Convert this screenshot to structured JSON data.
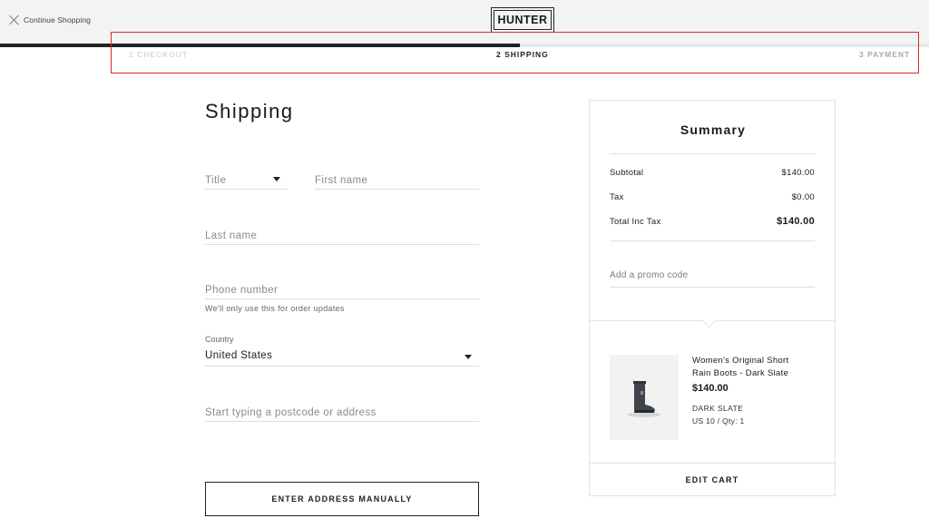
{
  "header": {
    "continue_label": "Continue Shopping",
    "logo_text": "HUNTER"
  },
  "progress": {
    "fraction_complete": 0.56
  },
  "steps": [
    {
      "label": "1 CHECKOUT",
      "state": "completed"
    },
    {
      "label": "2 SHIPPING",
      "state": "current"
    },
    {
      "label": "3 PAYMENT",
      "state": "upcoming"
    }
  ],
  "form": {
    "heading": "Shipping",
    "title_placeholder": "Title",
    "first_name_placeholder": "First name",
    "last_name_placeholder": "Last name",
    "phone_placeholder": "Phone number",
    "phone_hint": "We'll only use this for order updates",
    "country_label": "Country",
    "country_value": "United States",
    "address_placeholder": "Start typing a postcode or address",
    "manual_button": "ENTER ADDRESS MANUALLY"
  },
  "summary": {
    "heading": "Summary",
    "subtotal_label": "Subtotal",
    "subtotal_value": "$140.00",
    "tax_label": "Tax",
    "tax_value": "$0.00",
    "total_label": "Total Inc Tax",
    "total_value": "$140.00",
    "promo_placeholder": "Add a promo code",
    "item": {
      "name": "Women's Original Short Rain Boots - Dark Slate",
      "price": "$140.00",
      "color": "DARK SLATE",
      "size_qty": "US 10 / Qty: 1"
    },
    "edit_cart": "EDIT CART"
  },
  "colors": {
    "accent": "#222222",
    "highlight_box": "#d8282c"
  }
}
